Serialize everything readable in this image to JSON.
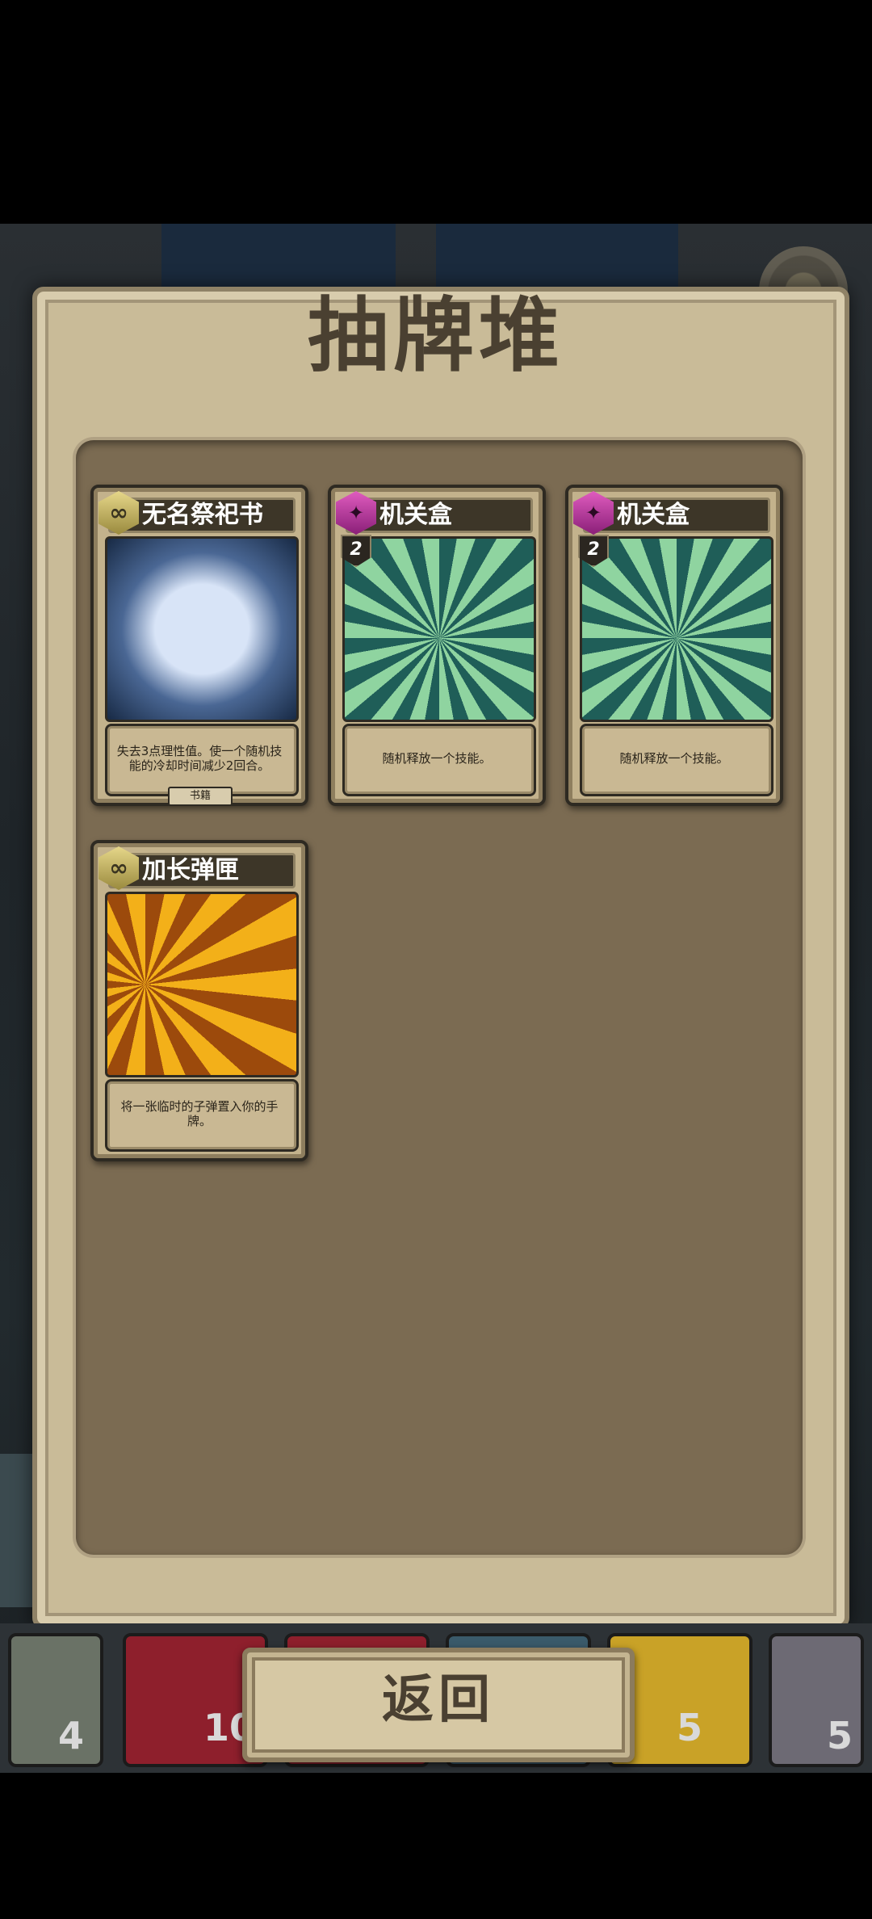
{
  "panel": {
    "title": "抽牌堆"
  },
  "cards": [
    {
      "name": "无名祭祀书",
      "badge": "gold",
      "badge_icon": "infinity-icon",
      "cost": "",
      "art": "book",
      "description": "失去3点理性值。使一个随机技能的冷却时间减少2回合。",
      "tag": "书籍"
    },
    {
      "name": "机关盒",
      "badge": "pink",
      "badge_icon": "pentagram-icon",
      "cost": "2",
      "art": "box",
      "description": "随机释放一个技能。",
      "tag": ""
    },
    {
      "name": "机关盒",
      "badge": "pink",
      "badge_icon": "pentagram-icon",
      "cost": "2",
      "art": "box",
      "description": "随机释放一个技能。",
      "tag": ""
    },
    {
      "name": "加长弹匣",
      "badge": "gold",
      "badge_icon": "infinity-icon",
      "cost": "",
      "art": "ammo",
      "description": "将一张临时的子弹置入你的手牌。",
      "tag": ""
    }
  ],
  "bottom": {
    "back_label": "返回",
    "slots": [
      {
        "icon": "deck-question-icon",
        "count": "4",
        "color": "#6a7266"
      },
      {
        "icon": "fist-card-icon",
        "count": "10",
        "color": "#8e1f2c"
      },
      {
        "icon": "red-card-icon",
        "count": "",
        "color": "#8e1f2c"
      },
      {
        "icon": "blue-card-icon",
        "count": "",
        "color": "#3a5a6a"
      },
      {
        "icon": "dancer-card-icon",
        "count": "5",
        "color": "#c9a227"
      },
      {
        "icon": "discard-spiral-icon",
        "count": "5",
        "color": "#6d6a74"
      }
    ]
  }
}
